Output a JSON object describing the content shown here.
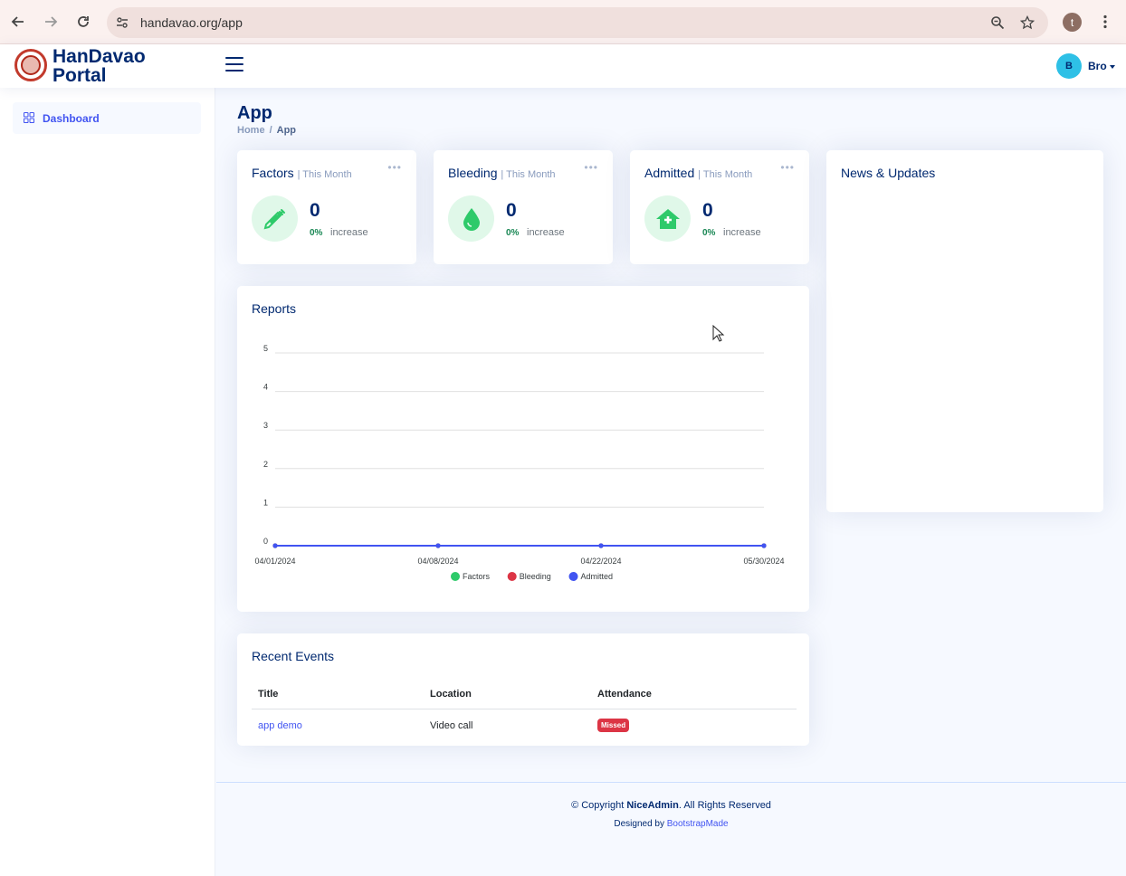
{
  "browser": {
    "url": "handavao.org/app",
    "profile_initial": "t"
  },
  "header": {
    "brand_line1": "HanDavao",
    "brand_line2": "Portal",
    "user_initial": "B",
    "user_name": "Bro"
  },
  "sidebar": {
    "items": [
      {
        "label": "Dashboard",
        "icon": "grid-icon",
        "active": true
      }
    ]
  },
  "page": {
    "title": "App",
    "breadcrumb": [
      "Home",
      "App"
    ]
  },
  "stats": [
    {
      "title": "Factors",
      "period": "| This Month",
      "value": "0",
      "percent": "0%",
      "trend": "increase",
      "icon": "syringe-icon"
    },
    {
      "title": "Bleeding",
      "period": "| This Month",
      "value": "0",
      "percent": "0%",
      "trend": "increase",
      "icon": "droplet-icon"
    },
    {
      "title": "Admitted",
      "period": "| This Month",
      "value": "0",
      "percent": "0%",
      "trend": "increase",
      "icon": "hospital-icon"
    }
  ],
  "news": {
    "title": "News & Updates"
  },
  "reports": {
    "title": "Reports",
    "chart_data": {
      "type": "line",
      "x": [
        "04/01/2024",
        "04/08/2024",
        "04/22/2024",
        "05/30/2024"
      ],
      "ylim": [
        0,
        5
      ],
      "yticks": [
        0,
        1,
        2,
        3,
        4,
        5
      ],
      "grid": true,
      "legend_position": "bottom",
      "series": [
        {
          "name": "Factors",
          "color": "#2eca6a",
          "values": [
            0,
            0,
            0,
            0
          ]
        },
        {
          "name": "Bleeding",
          "color": "#dc3545",
          "values": [
            0,
            0,
            0,
            0
          ]
        },
        {
          "name": "Admitted",
          "color": "#4154f1",
          "values": [
            0,
            0,
            0,
            0
          ]
        }
      ]
    }
  },
  "events": {
    "title": "Recent Events",
    "columns": [
      "Title",
      "Location",
      "Attendance"
    ],
    "rows": [
      {
        "title": "app demo",
        "location": "Video call",
        "attendance": "Missed"
      }
    ]
  },
  "footer": {
    "copyright_prefix": "© Copyright ",
    "copyright_brand": "NiceAdmin",
    "copyright_suffix": ". All Rights Reserved",
    "designed_prefix": "Designed by ",
    "designed_link": "BootstrapMade"
  }
}
